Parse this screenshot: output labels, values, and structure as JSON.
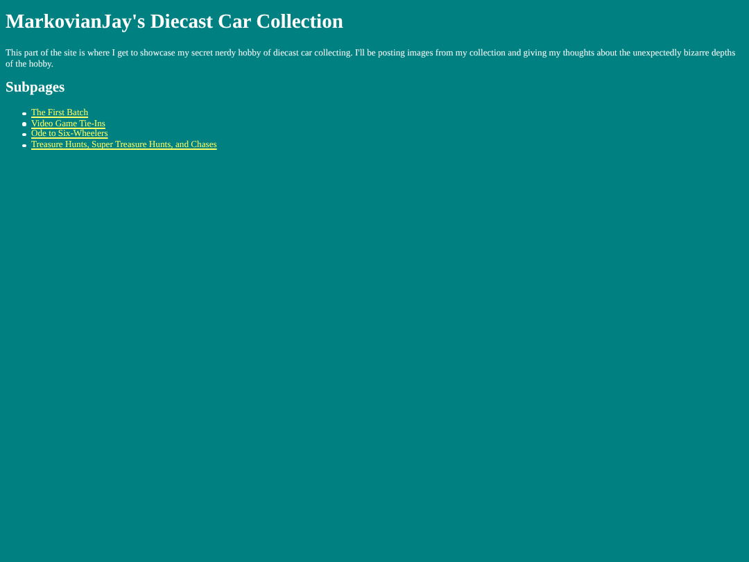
{
  "title": "MarkovianJay's Diecast Car Collection",
  "intro": "This part of the site is where I get to showcase my secret nerdy hobby of diecast car collecting. I'll be posting images from my collection and giving my thoughts about the unexpectedly bizarre depths of the hobby.",
  "subpages": {
    "heading": "Subpages",
    "links": [
      {
        "label": "The First Batch"
      },
      {
        "label": "Video Game Tie-Ins"
      },
      {
        "label": "Ode to Six-Wheelers"
      },
      {
        "label": "Treasure Hunts, Super Treasure Hunts, and Chases"
      }
    ]
  }
}
